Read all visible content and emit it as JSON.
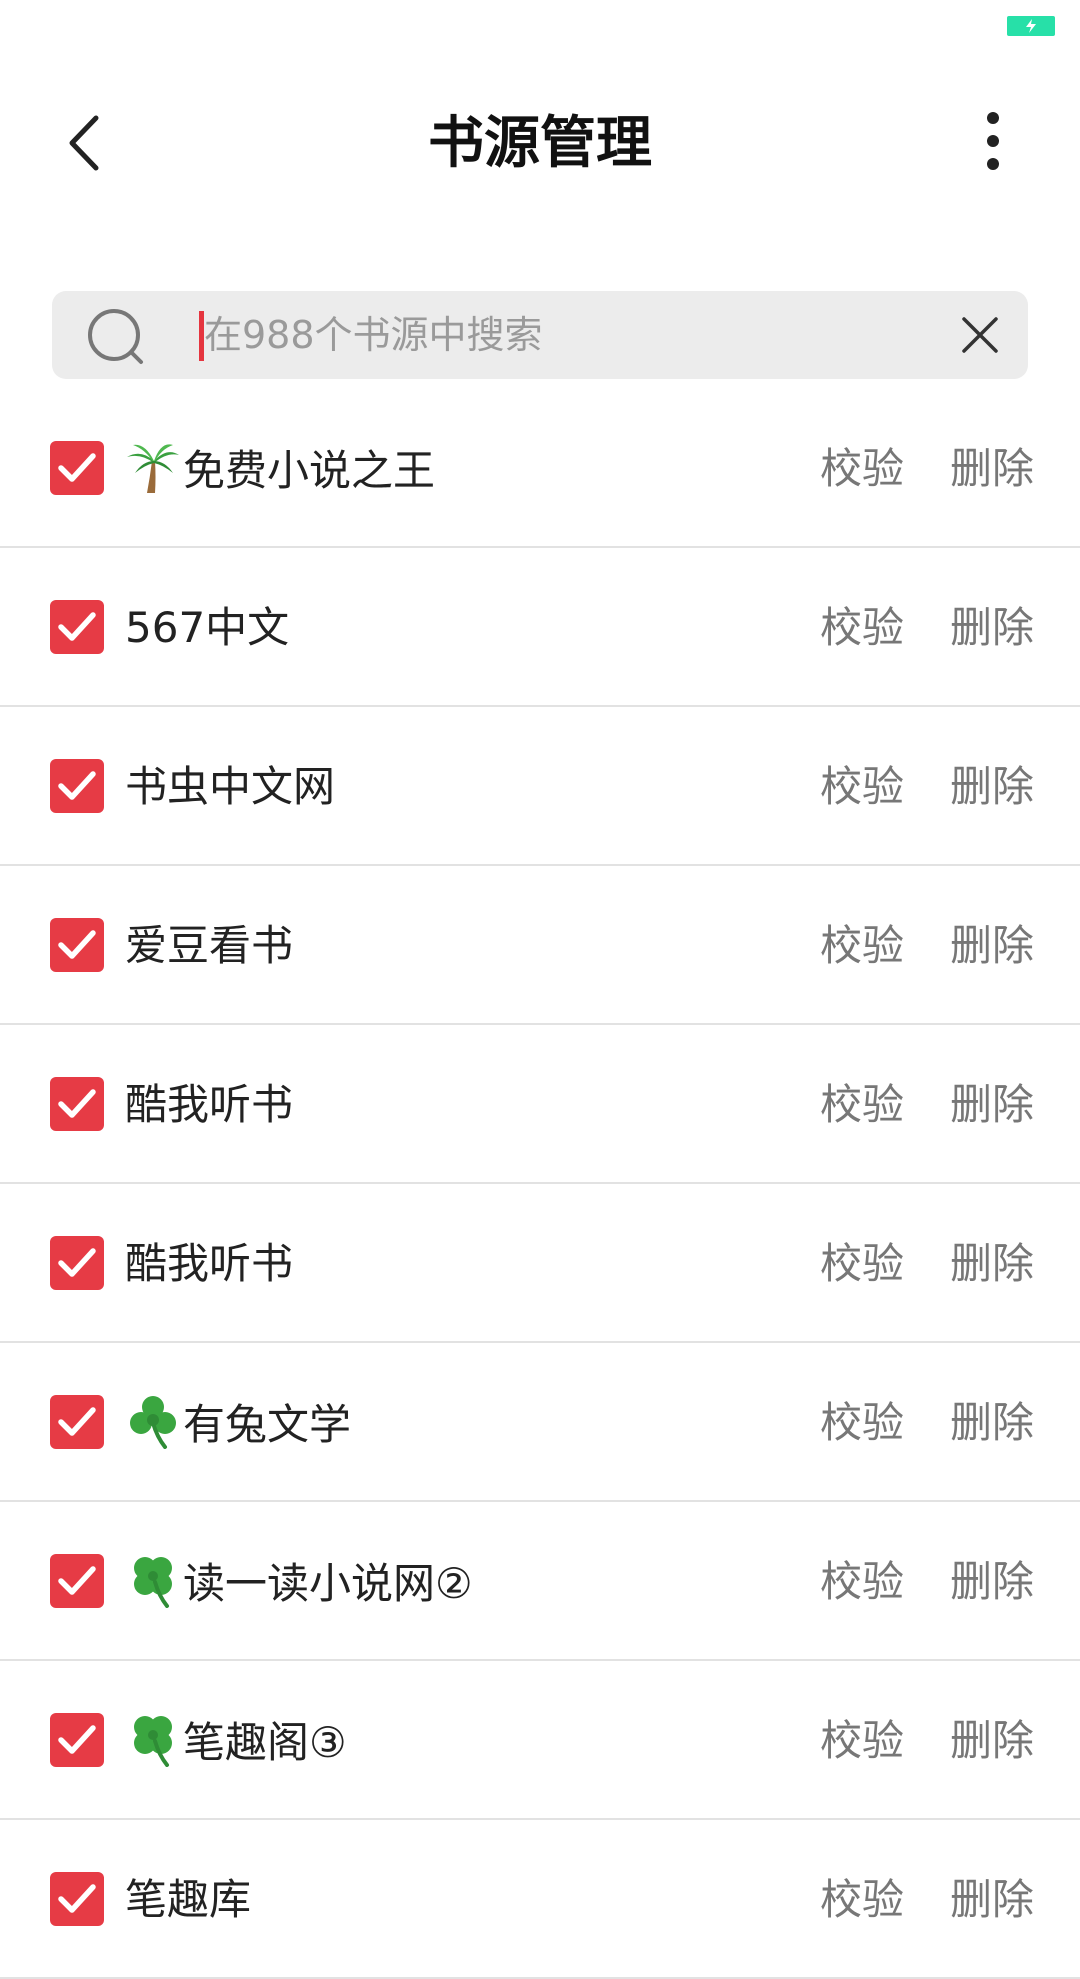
{
  "header": {
    "title": "书源管理"
  },
  "search": {
    "placeholder": "在988个书源中搜索",
    "value": ""
  },
  "colors": {
    "accent": "#e63b45",
    "battery": "#27e0a8",
    "search_bg": "#ececec",
    "divider": "#e2e2e2",
    "action_text": "#777777"
  },
  "actions": {
    "verify_label": "校验",
    "delete_label": "删除"
  },
  "sources": [
    {
      "name": "免费小说之王",
      "icon": "palm-tree-icon",
      "checked": true
    },
    {
      "name": "567中文",
      "icon": "",
      "checked": true
    },
    {
      "name": "书虫中文网",
      "icon": "",
      "checked": true
    },
    {
      "name": "爱豆看书",
      "icon": "",
      "checked": true
    },
    {
      "name": "酷我听书",
      "icon": "",
      "checked": true
    },
    {
      "name": " 酷我听书",
      "icon": "",
      "checked": true
    },
    {
      "name": "有兔文学",
      "icon": "shamrock-icon",
      "checked": true
    },
    {
      "name": "读一读小说网②",
      "icon": "four-leaf-clover-icon",
      "checked": true
    },
    {
      "name": "笔趣阁③",
      "icon": "four-leaf-clover-icon",
      "checked": true
    },
    {
      "name": "笔趣库",
      "icon": "",
      "checked": true
    }
  ]
}
